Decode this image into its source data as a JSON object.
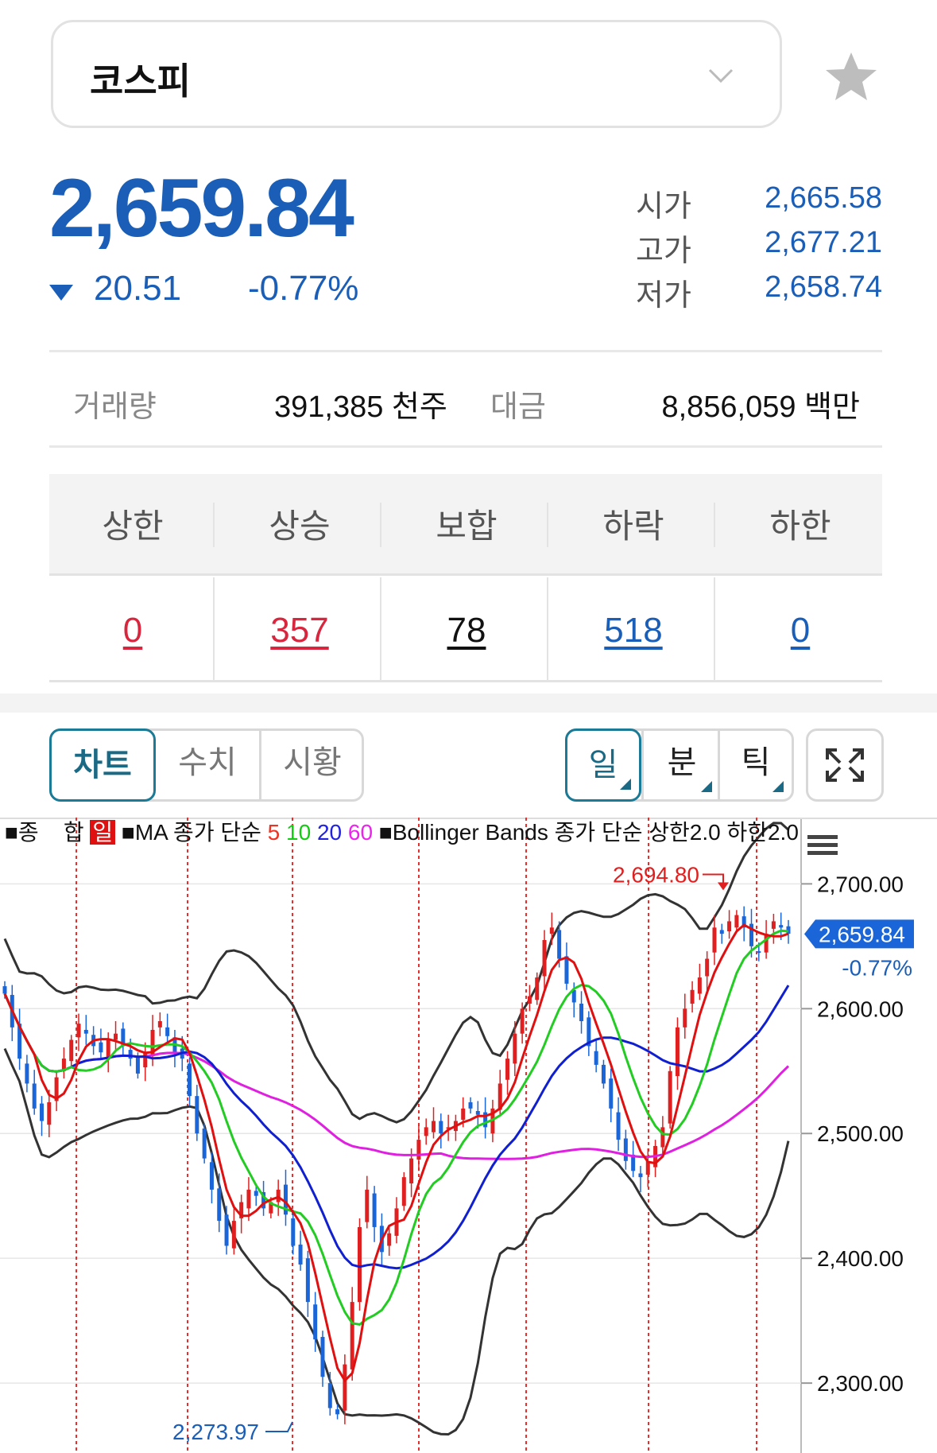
{
  "header": {
    "index_name": "코스피"
  },
  "quote": {
    "price": "2,659.84",
    "change": "20.51",
    "change_pct": "-0.77%",
    "direction": "down",
    "open_label": "시가",
    "open": "2,665.58",
    "high_label": "고가",
    "high": "2,677.21",
    "low_label": "저가",
    "low": "2,658.74"
  },
  "volume": {
    "volume_label": "거래량",
    "volume": "391,385 천주",
    "amount_label": "대금",
    "amount": "8,856,059 백만"
  },
  "breadth": {
    "headers": [
      "상한",
      "상승",
      "보합",
      "하락",
      "하한"
    ],
    "values": [
      "0",
      "357",
      "78",
      "518",
      "0"
    ]
  },
  "view_tabs": [
    "차트",
    "수치",
    "시황"
  ],
  "period_tabs": [
    "일",
    "분",
    "틱"
  ],
  "colors": {
    "up": "#d7263d",
    "down": "#1a5eb8",
    "accent": "#1b7a95"
  },
  "icons": [
    "chevron-down-icon",
    "star-icon",
    "expand-icon",
    "hamburger-icon",
    "triangle-down-icon"
  ],
  "chart_legend": {
    "item1": "■종",
    "item2": "합",
    "badge": "일",
    "ma_prefix": "■MA 종가 단순",
    "ma5": "5",
    "ma10": "10",
    "ma20": "20",
    "ma60": "60",
    "bb": "■Bollinger Bands 종가 단순 상한2.0 하한2.0"
  },
  "chart_data": {
    "type": "candlestick",
    "title": "",
    "y_ticks": [
      2700,
      2600,
      2500,
      2400,
      2300
    ],
    "y_tick_labels": [
      "2,700.00",
      "2,600.00",
      "2,500.00",
      "2,400.00",
      "2,300.00"
    ],
    "ylim": [
      2244,
      2734
    ],
    "current_price_label": "2,659.84",
    "current_change_label": "-0.77%",
    "max_annotation": "2,694.80",
    "min_annotation": "2,273.97",
    "max_value": 2694.8,
    "min_value": 2273.97,
    "closes": [
      2612,
      2585,
      2560,
      2540,
      2520,
      2510,
      2525,
      2545,
      2560,
      2575,
      2588,
      2580,
      2570,
      2565,
      2575,
      2580,
      2570,
      2560,
      2548,
      2565,
      2583,
      2590,
      2578,
      2565,
      2560,
      2530,
      2500,
      2480,
      2455,
      2430,
      2410,
      2430,
      2445,
      2455,
      2450,
      2440,
      2445,
      2455,
      2435,
      2410,
      2395,
      2365,
      2335,
      2305,
      2280,
      2275,
      2315,
      2365,
      2425,
      2455,
      2425,
      2405,
      2420,
      2440,
      2465,
      2480,
      2495,
      2505,
      2510,
      2500,
      2505,
      2510,
      2520,
      2520,
      2515,
      2505,
      2520,
      2540,
      2560,
      2580,
      2600,
      2610,
      2625,
      2655,
      2665,
      2640,
      2620,
      2605,
      2590,
      2570,
      2555,
      2540,
      2520,
      2495,
      2478,
      2470,
      2465,
      2478,
      2490,
      2505,
      2550,
      2585,
      2600,
      2615,
      2625,
      2640,
      2665,
      2660,
      2670,
      2675,
      2665,
      2650,
      2645,
      2660,
      2670,
      2665,
      2660
    ]
  }
}
